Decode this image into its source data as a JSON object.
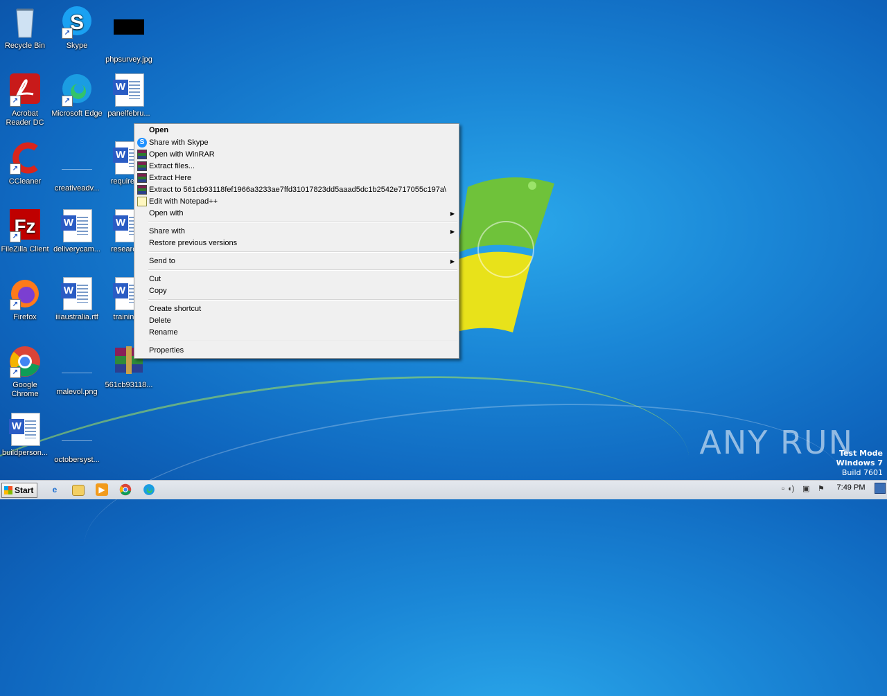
{
  "desktop": {
    "icons": [
      {
        "label": "Recycle Bin",
        "icon": "recycle-bin-icon"
      },
      {
        "label": "Skype",
        "icon": "skype-icon"
      },
      {
        "label": "phpsurvey.jpg",
        "icon": "image-file-icon"
      },
      {
        "label": "Acrobat Reader DC",
        "icon": "acrobat-icon"
      },
      {
        "label": "Microsoft Edge",
        "icon": "edge-icon"
      },
      {
        "label": "panelfebru...",
        "icon": "word-doc-icon"
      },
      {
        "label": "CCleaner",
        "icon": "ccleaner-icon"
      },
      {
        "label": "creativeadv...",
        "icon": "blank-file-icon"
      },
      {
        "label": "requirem...",
        "icon": "word-doc-icon"
      },
      {
        "label": "FileZilla Client",
        "icon": "filezilla-icon"
      },
      {
        "label": "deliverycam...",
        "icon": "word-doc-icon"
      },
      {
        "label": "research...",
        "icon": "word-doc-icon"
      },
      {
        "label": "Firefox",
        "icon": "firefox-icon"
      },
      {
        "label": "iiiaustralia.rtf",
        "icon": "word-doc-icon"
      },
      {
        "label": "training...",
        "icon": "word-doc-icon"
      },
      {
        "label": "Google Chrome",
        "icon": "chrome-icon"
      },
      {
        "label": "malevol.png",
        "icon": "blank-file-icon"
      },
      {
        "label": "561cb93118...",
        "icon": "winrar-archive-icon"
      },
      {
        "label": "buildperson...",
        "icon": "word-doc-icon"
      },
      {
        "label": "octobersyst...",
        "icon": "blank-file-icon"
      }
    ]
  },
  "context_menu": {
    "items": [
      {
        "label": "Open",
        "bold": true,
        "icon": ""
      },
      {
        "label": "Share with Skype",
        "icon": "skype-icon"
      },
      {
        "label": "Open with WinRAR",
        "icon": "winrar-icon"
      },
      {
        "label": "Extract files...",
        "icon": "winrar-icon"
      },
      {
        "label": "Extract Here",
        "icon": "winrar-icon"
      },
      {
        "label": "Extract to 561cb93118fef1966a3233ae7ffd31017823dd5aaad5dc1b2542e717055c197a\\",
        "icon": "winrar-icon"
      },
      {
        "label": "Edit with Notepad++",
        "icon": "notepadpp-icon"
      },
      {
        "label": "Open with",
        "submenu": true
      },
      {
        "label": "Share with",
        "submenu": true
      },
      {
        "label": "Restore previous versions"
      },
      {
        "label": "Send to",
        "submenu": true
      },
      {
        "label": "Cut"
      },
      {
        "label": "Copy"
      },
      {
        "label": "Create shortcut"
      },
      {
        "label": "Delete"
      },
      {
        "label": "Rename"
      },
      {
        "label": "Properties"
      }
    ]
  },
  "taskbar": {
    "start_label": "Start",
    "pinned": [
      "internet-explorer-icon",
      "explorer-folder-icon",
      "media-player-icon",
      "chrome-icon",
      "edge-icon"
    ],
    "clock": "7:49 PM"
  },
  "watermark": {
    "brand": "ANY RUN",
    "test_mode": "Test Mode",
    "os": "Windows 7",
    "build": "Build 7601"
  },
  "colors": {
    "menu_bg": "#f0f0f0",
    "desktop_blue": "#1a86d6",
    "taskbar": "#dfe3e9"
  }
}
